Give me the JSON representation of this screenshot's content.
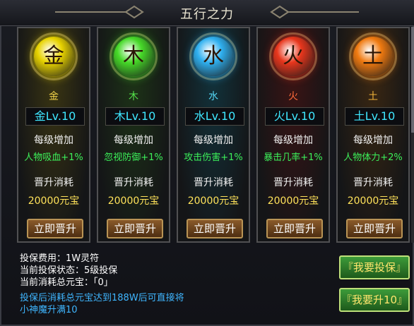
{
  "window": {
    "title": "五行之力"
  },
  "elements": [
    {
      "name": "金",
      "char": "金",
      "level_label": "金Lv.10",
      "per_level_label": "每级增加",
      "bonus": "人物吸血+1%",
      "cost_label": "晋升消耗",
      "cost": "20000元宝",
      "button": "立即晋升",
      "name_color": "#f0d24a",
      "orb": "#e8d300",
      "bg": "#3a3512"
    },
    {
      "name": "木",
      "char": "木",
      "level_label": "木Lv.10",
      "per_level_label": "每级增加",
      "bonus": "忽视防御+1%",
      "cost_label": "晋升消耗",
      "cost": "20000元宝",
      "button": "立即晋升",
      "name_color": "#55e24a",
      "orb": "#46d928",
      "bg": "#1d3317"
    },
    {
      "name": "水",
      "char": "水",
      "level_label": "水Lv.10",
      "per_level_label": "每级增加",
      "bonus": "攻击伤害+1%",
      "cost_label": "晋升消耗",
      "cost": "20000元宝",
      "button": "立即晋升",
      "name_color": "#54d6f5",
      "orb": "#2fb0f0",
      "bg": "#12323b"
    },
    {
      "name": "火",
      "char": "火",
      "level_label": "火Lv.10",
      "per_level_label": "每级增加",
      "bonus": "暴击几率+1%",
      "cost_label": "晋升消耗",
      "cost": "20000元宝",
      "button": "立即晋升",
      "name_color": "#ff6a3a",
      "orb": "#e8361c",
      "bg": "#3a1414"
    },
    {
      "name": "土",
      "char": "土",
      "level_label": "土Lv.10",
      "per_level_label": "每级增加",
      "bonus": "人物体力+2%",
      "cost_label": "晋升消耗",
      "cost": "20000元宝",
      "button": "立即晋升",
      "name_color": "#f2b43a",
      "orb": "#f07a10",
      "bg": "#3a2712"
    }
  ],
  "info": {
    "fee": "投保费用：1W灵符",
    "status": "当前投保状态：5级投保",
    "total": "当前消耗总元宝：「0」",
    "notice_line1": "投保后消耗总元宝达到188W后可直接将",
    "notice_line2": "小神魔升满10"
  },
  "buttons": {
    "insure": "『我要投保』",
    "upgrade10": "『我要升10』"
  },
  "colors": {
    "notice": "#3fb6ff",
    "info": "#ffffff",
    "bonus": "#3cf05a",
    "cost": "#ffe25a",
    "level": "#3fe7ff"
  }
}
